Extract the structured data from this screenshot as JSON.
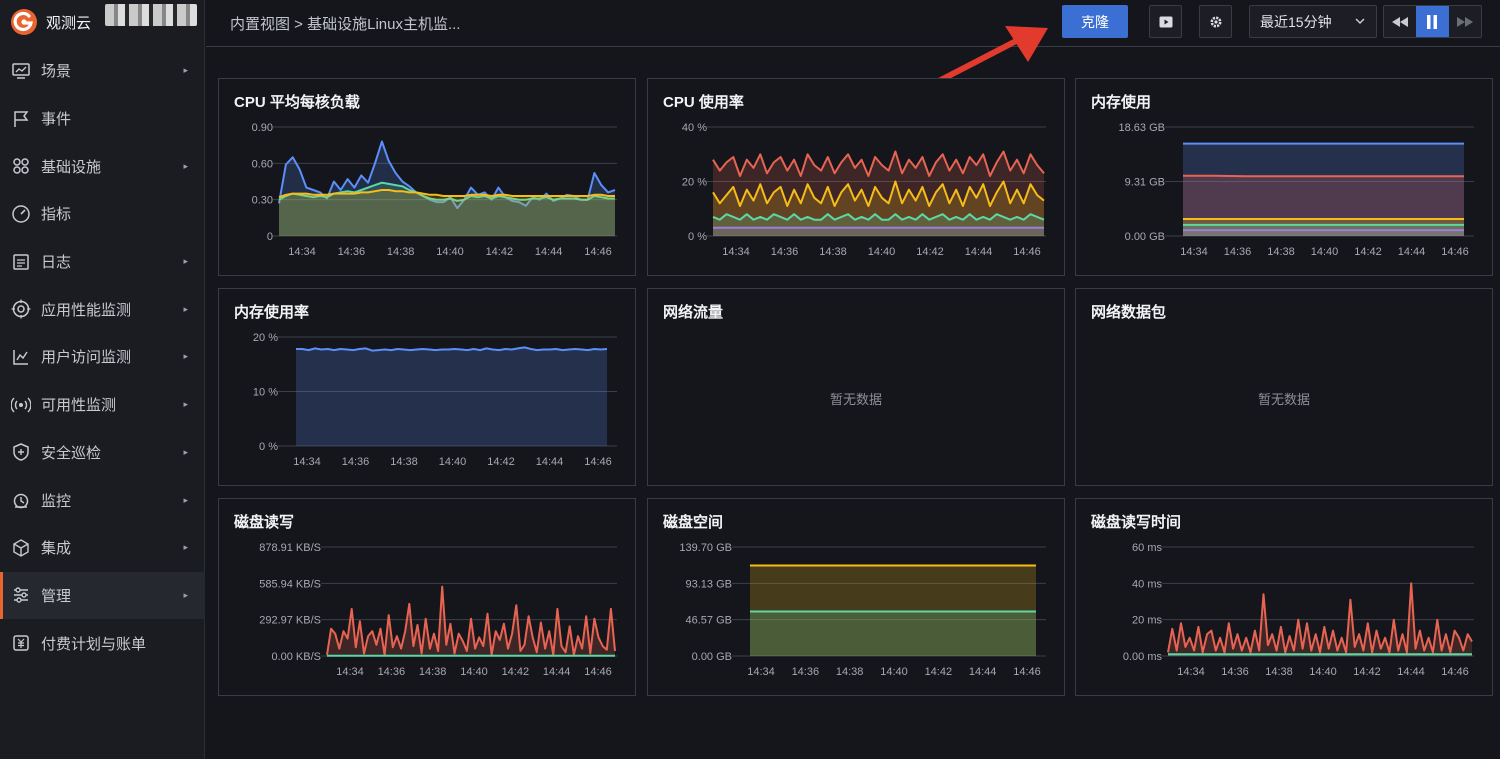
{
  "app": {
    "name": "观测云",
    "more": ".."
  },
  "sidebar": {
    "items": [
      {
        "label": "场景",
        "arrow": true,
        "icon": "monitor-icon"
      },
      {
        "label": "事件",
        "arrow": false,
        "icon": "flag-icon"
      },
      {
        "label": "基础设施",
        "arrow": true,
        "icon": "nodes-icon"
      },
      {
        "label": "指标",
        "arrow": false,
        "icon": "gauge-icon"
      },
      {
        "label": "日志",
        "arrow": true,
        "icon": "log-icon"
      },
      {
        "label": "应用性能监测",
        "arrow": true,
        "icon": "target-icon"
      },
      {
        "label": "用户访问监测",
        "arrow": true,
        "icon": "chart-icon"
      },
      {
        "label": "可用性监测",
        "arrow": true,
        "icon": "signal-icon"
      },
      {
        "label": "安全巡检",
        "arrow": true,
        "icon": "shield-icon"
      },
      {
        "label": "监控",
        "arrow": true,
        "icon": "alarm-icon"
      },
      {
        "label": "集成",
        "arrow": true,
        "icon": "cube-icon"
      },
      {
        "label": "管理",
        "arrow": true,
        "icon": "sliders-icon",
        "active": true
      },
      {
        "label": "付费计划与账单",
        "arrow": false,
        "icon": "bill-icon"
      }
    ]
  },
  "header": {
    "breadcrumb": "内置视图 > 基础设施Linux主机监...",
    "clone_label": "克隆",
    "time_range": "最近15分钟"
  },
  "colors": {
    "accent": "#3b6fd4",
    "active_bar": "#e8652f",
    "arrow": "#e23b2e"
  },
  "x_ticks": [
    "14:34",
    "14:36",
    "14:38",
    "14:40",
    "14:42",
    "14:44",
    "14:46"
  ],
  "empty_text": "暂无数据",
  "chart_data": [
    {
      "title": "CPU 平均每核负载",
      "type": "area",
      "yticks": [
        "0.90",
        "0.60",
        "0.30",
        "0"
      ],
      "ylim": [
        0,
        0.9
      ],
      "series": [
        {
          "color": "#5b8ff9",
          "values": [
            0.27,
            0.59,
            0.65,
            0.55,
            0.4,
            0.38,
            0.36,
            0.31,
            0.45,
            0.38,
            0.47,
            0.4,
            0.5,
            0.44,
            0.6,
            0.78,
            0.62,
            0.52,
            0.45,
            0.41,
            0.36,
            0.33,
            0.3,
            0.28,
            0.28,
            0.32,
            0.23,
            0.3,
            0.4,
            0.34,
            0.36,
            0.3,
            0.4,
            0.32,
            0.29,
            0.28,
            0.25,
            0.32,
            0.3,
            0.35,
            0.29,
            0.31,
            0.34,
            0.33,
            0.3,
            0.3,
            0.52,
            0.42,
            0.36,
            0.38
          ]
        },
        {
          "color": "#5ad8a6",
          "values": [
            0.3,
            0.33,
            0.35,
            0.34,
            0.33,
            0.32,
            0.33,
            0.32,
            0.35,
            0.36,
            0.37,
            0.36,
            0.38,
            0.4,
            0.42,
            0.44,
            0.43,
            0.42,
            0.41,
            0.38,
            0.36,
            0.33,
            0.31,
            0.3,
            0.3,
            0.31,
            0.29,
            0.3,
            0.33,
            0.32,
            0.33,
            0.31,
            0.33,
            0.32,
            0.31,
            0.3,
            0.3,
            0.31,
            0.31,
            0.32,
            0.3,
            0.31,
            0.31,
            0.31,
            0.3,
            0.3,
            0.33,
            0.32,
            0.31,
            0.31
          ]
        },
        {
          "color": "#f6bd16",
          "values": [
            0.32,
            0.34,
            0.35,
            0.35,
            0.35,
            0.34,
            0.34,
            0.34,
            0.35,
            0.35,
            0.35,
            0.35,
            0.36,
            0.36,
            0.37,
            0.38,
            0.38,
            0.37,
            0.37,
            0.36,
            0.36,
            0.35,
            0.34,
            0.34,
            0.33,
            0.33,
            0.33,
            0.33,
            0.34,
            0.34,
            0.34,
            0.33,
            0.34,
            0.34,
            0.33,
            0.33,
            0.33,
            0.33,
            0.33,
            0.33,
            0.33,
            0.33,
            0.33,
            0.33,
            0.33,
            0.33,
            0.34,
            0.34,
            0.33,
            0.33
          ]
        }
      ]
    },
    {
      "title": "CPU 使用率",
      "type": "area",
      "yticks": [
        "40 %",
        "20 %",
        "0 %"
      ],
      "ylim": [
        0,
        40
      ],
      "series": [
        {
          "color": "#e86452",
          "values": [
            28,
            24,
            27,
            29,
            22,
            28,
            25,
            30,
            23,
            27,
            29,
            24,
            28,
            22,
            30,
            26,
            24,
            29,
            23,
            27,
            30,
            25,
            28,
            22,
            29,
            26,
            24,
            31,
            23,
            28,
            25,
            29,
            22,
            27,
            30,
            24,
            28,
            23,
            29,
            26,
            30,
            22,
            27,
            31,
            24,
            28,
            23,
            30,
            26,
            23
          ]
        },
        {
          "color": "#f6bd16",
          "values": [
            16,
            12,
            15,
            18,
            11,
            17,
            13,
            19,
            12,
            16,
            18,
            11,
            17,
            12,
            19,
            14,
            12,
            18,
            11,
            16,
            19,
            13,
            17,
            11,
            18,
            14,
            12,
            20,
            12,
            17,
            13,
            18,
            11,
            16,
            19,
            12,
            17,
            11,
            18,
            14,
            19,
            11,
            16,
            20,
            12,
            17,
            12,
            19,
            15,
            13
          ]
        },
        {
          "color": "#5ad8a6",
          "values": [
            7,
            6,
            8,
            7,
            6,
            8,
            6,
            7,
            6,
            8,
            7,
            6,
            8,
            6,
            7,
            6,
            6,
            8,
            6,
            7,
            8,
            6,
            7,
            6,
            8,
            6,
            6,
            8,
            6,
            7,
            6,
            8,
            6,
            7,
            8,
            6,
            7,
            6,
            8,
            6,
            7,
            6,
            8,
            7,
            6,
            7,
            6,
            8,
            7,
            6
          ]
        },
        {
          "color": "#9b7ede",
          "values": [
            3,
            3,
            3,
            3,
            3,
            3,
            3,
            3,
            3,
            3,
            3,
            3,
            3,
            3,
            3,
            3,
            3,
            3,
            3,
            3,
            3,
            3,
            3,
            3,
            3,
            3,
            3,
            3,
            3,
            3,
            3,
            3,
            3,
            3,
            3,
            3,
            3,
            3,
            3,
            3,
            3,
            3,
            3,
            3,
            3,
            3,
            3,
            3,
            3,
            3
          ]
        }
      ]
    },
    {
      "title": "内存使用",
      "type": "area",
      "yticks": [
        "18.63 GB",
        "9.31 GB",
        "0.00 GB"
      ],
      "ylim": [
        0,
        18.63
      ],
      "series": [
        {
          "color": "#5b8ff9",
          "values": [
            15.8,
            15.8,
            15.8,
            15.8,
            15.8,
            15.8,
            15.8,
            15.8,
            15.8,
            15.8
          ]
        },
        {
          "color": "#e86452",
          "values": [
            10.3,
            10.3,
            10.2,
            10.2,
            10.2,
            10.2,
            10.2,
            10.2,
            10.2,
            10.2
          ]
        },
        {
          "color": "#f6bd16",
          "values": [
            2.9,
            2.9,
            2.9,
            2.9,
            2.9,
            2.9,
            2.9,
            2.9,
            2.9,
            2.9
          ]
        },
        {
          "color": "#5ad8a6",
          "values": [
            1.9,
            1.9,
            1.9,
            1.9,
            1.9,
            1.9,
            1.9,
            1.9,
            1.9,
            1.9
          ]
        },
        {
          "color": "#9b7ede",
          "values": [
            1.0,
            1.0,
            1.0,
            1.0,
            1.0,
            1.0,
            1.0,
            1.0,
            1.0,
            1.0
          ]
        }
      ]
    },
    {
      "title": "内存使用率",
      "type": "area",
      "yticks": [
        "20 %",
        "10 %",
        "0 %"
      ],
      "ylim": [
        0,
        20
      ],
      "series": [
        {
          "color": "#5b8ff9",
          "values": [
            17.8,
            17.8,
            17.6,
            17.9,
            17.7,
            17.8,
            17.6,
            17.8,
            17.7,
            17.6,
            17.8,
            17.9,
            17.5,
            17.6,
            17.7,
            17.6,
            17.8,
            17.7,
            17.6,
            17.7,
            17.8,
            17.7,
            17.6,
            17.7,
            17.7,
            17.8,
            17.7,
            17.6,
            17.8,
            17.6,
            17.9,
            17.7,
            17.6,
            17.8,
            17.7,
            17.9,
            18.1,
            17.8,
            17.6,
            17.7,
            17.7,
            17.8,
            17.6,
            17.7,
            17.8,
            17.7,
            17.6,
            17.8,
            17.7,
            17.8
          ]
        }
      ]
    },
    {
      "title": "网络流量",
      "type": "empty"
    },
    {
      "title": "网络数据包",
      "type": "empty"
    },
    {
      "title": "磁盘读写",
      "type": "area",
      "yticks": [
        "878.91 KB/S",
        "585.94 KB/S",
        "292.97 KB/S",
        "0.00 KB/S"
      ],
      "ylim": [
        0,
        878.91
      ],
      "series": [
        {
          "color": "#e86452",
          "values": [
            10,
            220,
            180,
            60,
            200,
            140,
            380,
            70,
            280,
            20,
            160,
            200,
            90,
            220,
            10,
            330,
            70,
            160,
            60,
            200,
            420,
            80,
            250,
            20,
            300,
            60,
            180,
            40,
            560,
            90,
            260,
            20,
            180,
            120,
            40,
            300,
            60,
            150,
            80,
            340,
            10,
            200,
            130,
            260,
            60,
            180,
            410,
            40,
            90,
            320,
            150,
            30,
            270,
            60,
            200,
            10,
            380,
            80,
            30,
            240,
            10,
            160,
            60,
            320,
            20,
            300,
            150,
            80,
            50,
            380,
            40
          ]
        },
        {
          "color": "#5ad8a6",
          "values": [
            2,
            2,
            2,
            2,
            2,
            2,
            2,
            2,
            2,
            2,
            2,
            2,
            2,
            2,
            2,
            2,
            2,
            2,
            2,
            2,
            2,
            2,
            2,
            2,
            2,
            2,
            2,
            2,
            2,
            2,
            2,
            2,
            2,
            2,
            2,
            2,
            2,
            2,
            2,
            2,
            2,
            2,
            2,
            2,
            2,
            2,
            2,
            2,
            2,
            2,
            2,
            2,
            2,
            2,
            2,
            2,
            2,
            2,
            2,
            2,
            2,
            2,
            2,
            2,
            2,
            2,
            2,
            2,
            2,
            2,
            2
          ]
        }
      ]
    },
    {
      "title": "磁盘空间",
      "type": "area",
      "yticks": [
        "139.70 GB",
        "93.13 GB",
        "46.57 GB",
        "0.00 GB"
      ],
      "ylim": [
        0,
        139.7
      ],
      "series": [
        {
          "color": "#f6bd16",
          "values": [
            116,
            116,
            116,
            116,
            116,
            116,
            116,
            116,
            116,
            116
          ]
        },
        {
          "color": "#5ad8a6",
          "values": [
            57,
            57,
            57,
            57,
            57,
            57,
            57,
            57,
            57,
            57
          ]
        }
      ]
    },
    {
      "title": "磁盘读写时间",
      "type": "area",
      "yticks": [
        "60 ms",
        "40 ms",
        "20 ms",
        "0.00 ms"
      ],
      "ylim": [
        0,
        60
      ],
      "series": [
        {
          "color": "#e86452",
          "values": [
            2,
            15,
            3,
            18,
            5,
            10,
            3,
            16,
            2,
            12,
            14,
            3,
            10,
            2,
            18,
            4,
            12,
            3,
            10,
            2,
            14,
            3,
            34,
            6,
            12,
            3,
            16,
            2,
            11,
            3,
            20,
            4,
            18,
            3,
            12,
            2,
            16,
            4,
            14,
            3,
            10,
            2,
            31,
            5,
            12,
            3,
            18,
            2,
            14,
            4,
            10,
            2,
            20,
            3,
            12,
            2,
            40,
            4,
            14,
            3,
            10,
            2,
            20,
            3,
            12,
            2,
            14,
            10,
            3,
            12,
            8
          ]
        },
        {
          "color": "#5ad8a6",
          "values": [
            1,
            1,
            1,
            1,
            1,
            1,
            1,
            1,
            1,
            1,
            1,
            1,
            1,
            1,
            1,
            1,
            1,
            1,
            1,
            1,
            1,
            1,
            1,
            1,
            1,
            1,
            1,
            1,
            1,
            1,
            1,
            1,
            1,
            1,
            1,
            1,
            1,
            1,
            1,
            1,
            1,
            1,
            1,
            1,
            1,
            1,
            1,
            1,
            1,
            1,
            1,
            1,
            1,
            1,
            1,
            1,
            1,
            1,
            1,
            1,
            1,
            1,
            1,
            1,
            1,
            1,
            1,
            1,
            1,
            1,
            1
          ]
        }
      ]
    }
  ]
}
